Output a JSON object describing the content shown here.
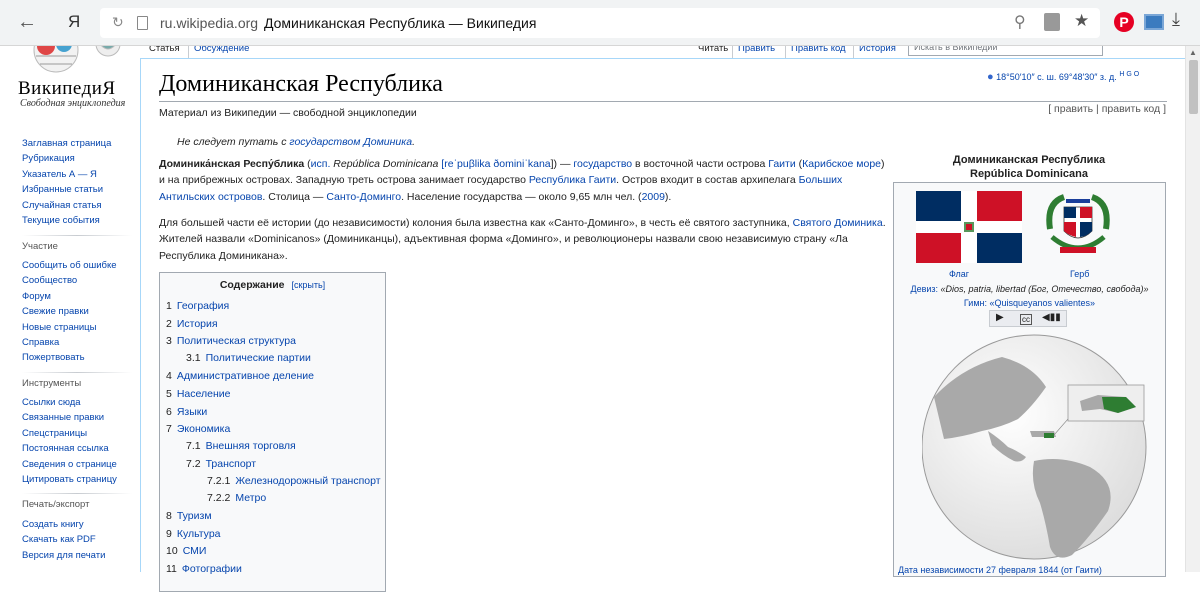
{
  "browser": {
    "yandex_label": "Я",
    "url_domain": "ru.wikipedia.org",
    "url_title": "Доминиканская Республика — Википедия",
    "pinterest_label": "P"
  },
  "sidebar": {
    "logo_name": "ВикипедиЯ",
    "logo_tagline": "Свободная энциклопедия",
    "main_items": [
      "Заглавная страница",
      "Рубрикация",
      "Указатель А — Я",
      "Избранные статьи",
      "Случайная статья",
      "Текущие события"
    ],
    "participation_title": "Участие",
    "participation_items": [
      "Сообщить об ошибке",
      "Сообщество",
      "Форум",
      "Свежие правки",
      "Новые страницы",
      "Справка",
      "Пожертвовать"
    ],
    "tools_title": "Инструменты",
    "tools_items": [
      "Ссылки сюда",
      "Связанные правки",
      "Спецстраницы",
      "Постоянная ссылка",
      "Сведения о странице",
      "Цитировать страницу"
    ],
    "print_title": "Печать/экспорт",
    "print_items": [
      "Создать книгу",
      "Скачать как PDF",
      "Версия для печати"
    ]
  },
  "tabs": {
    "article": "Статья",
    "discussion": "Обсуждение",
    "read": "Читать",
    "edit": "Править",
    "edit_code": "Править код",
    "history": "История",
    "search_placeholder": "Искать в Википедии"
  },
  "article": {
    "title": "Доминиканская Республика",
    "coords_pin": "●",
    "coords": "18°50′10″ с. ш. 69°48′30″ з. д.",
    "coords_sup": "H G O",
    "tagline": "Материал из Википедии — свободной энциклопедии",
    "edit_links": "[ править | править код ]",
    "hatnote_prefix": "Не следует путать с ",
    "hatnote_link": "государством Доминика",
    "hatnote_suffix": ".",
    "p1": {
      "t0": "Доминика́нская Респу́блика",
      "t1": " (",
      "t2": "исп.",
      "t3": " República Dominicana",
      "t4": " [",
      "t5": "reˈpuβlika ðominiˈkana",
      "t6": "]) — ",
      "t7": "государство",
      "t8": " в восточной части острова ",
      "t9": "Гаити",
      "t10": " (",
      "t11": "Карибское море",
      "t12": ") и на прибрежных островах. Западную треть острова занимает государство ",
      "t13": "Республика Гаити",
      "t14": ". Остров входит в состав архипелага ",
      "t15": "Больших Антильских островов",
      "t16": ". Столица — ",
      "t17": "Санто-Доминго",
      "t18": ". Население государства — около 9,65 млн чел. (",
      "t19": "2009",
      "t20": ")."
    },
    "p2": {
      "t0": "Для большей части её истории (до независимости) колония была известна как «Санто-Доминго», в честь её святого заступника, ",
      "t1": "Святого Доминика",
      "t2": ". Жителей назвали «Dominicanos» (Доминиканцы), адъективная форма «Доминго», и революционеры назвали свою независимую страну «Ла Республика Доминикана»."
    }
  },
  "toc": {
    "title": "Содержание",
    "hide": "[скрыть]",
    "items": [
      {
        "num": "1",
        "label": "География"
      },
      {
        "num": "2",
        "label": "История"
      },
      {
        "num": "3",
        "label": "Политическая структура"
      },
      {
        "num": "3.1",
        "label": "Политические партии"
      },
      {
        "num": "4",
        "label": "Административное деление"
      },
      {
        "num": "5",
        "label": "Население"
      },
      {
        "num": "6",
        "label": "Языки"
      },
      {
        "num": "7",
        "label": "Экономика"
      },
      {
        "num": "7.1",
        "label": "Внешняя торговля"
      },
      {
        "num": "7.2",
        "label": "Транспорт"
      },
      {
        "num": "7.2.1",
        "label": "Железнодорожный транспорт"
      },
      {
        "num": "7.2.2",
        "label": "Метро"
      },
      {
        "num": "8",
        "label": "Туризм"
      },
      {
        "num": "9",
        "label": "Культура"
      },
      {
        "num": "10",
        "label": "СМИ"
      },
      {
        "num": "11",
        "label": "Фотографии"
      }
    ]
  },
  "infobox": {
    "title_ru": "Доминиканская Республика",
    "title_es": "República Dominicana",
    "flag_label": "Флаг",
    "coat_label": "Герб",
    "motto_label": "Девиз: ",
    "motto_value": "«Dios, patria, libertad (Бог, Отечество, свобода)»",
    "anthem_label": "Гимн: ",
    "anthem_value": "«Quisqueyanos valientes»",
    "bottom_caption": "Дата независимости 27 февраля 1844 (от Гаити)",
    "colors": {
      "flag_blue": "#002d62",
      "flag_red": "#ce1126",
      "land": "#9a9a9a",
      "highlight": "#2e7d32"
    }
  }
}
